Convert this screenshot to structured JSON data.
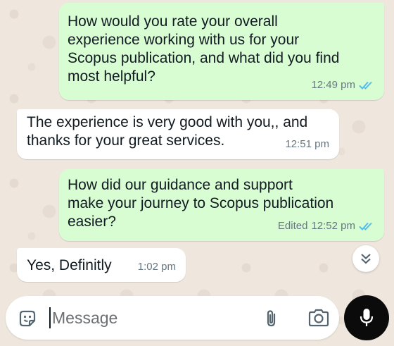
{
  "messages": [
    {
      "id": "m1",
      "direction": "outgoing",
      "text": "How would you rate your overall\nexperience working with us for your\nScopus publication, and what did you find\nmost helpful?",
      "time": "12:49 pm",
      "edited_label": "",
      "status_icon": "double-check-icon"
    },
    {
      "id": "m2",
      "direction": "incoming",
      "text": "The experience is very good with you,, and\nthanks for your great services.",
      "time": "12:51 pm",
      "edited_label": ""
    },
    {
      "id": "m3",
      "direction": "outgoing",
      "text": "How did our guidance and support\nmake your journey to Scopus publication\neasier?",
      "time": "12:52 pm",
      "edited_label": "Edited",
      "status_icon": "double-check-icon"
    },
    {
      "id": "m4",
      "direction": "incoming",
      "text": "Yes, Definitly",
      "time": "1:02 pm",
      "edited_label": ""
    }
  ],
  "composer": {
    "placeholder": "Message",
    "icons": [
      "emoji-icon",
      "attach-icon",
      "camera-icon",
      "mic-icon"
    ]
  },
  "scroll_button_icon": "chevron-down-double-icon",
  "colors": {
    "outgoing_bubble": "#d9fdd3",
    "incoming_bubble": "#ffffff",
    "chat_background": "#efe7de",
    "read_tick": "#53bdeb",
    "mic_button": "#0b0b0b",
    "timestamp": "#667781"
  }
}
